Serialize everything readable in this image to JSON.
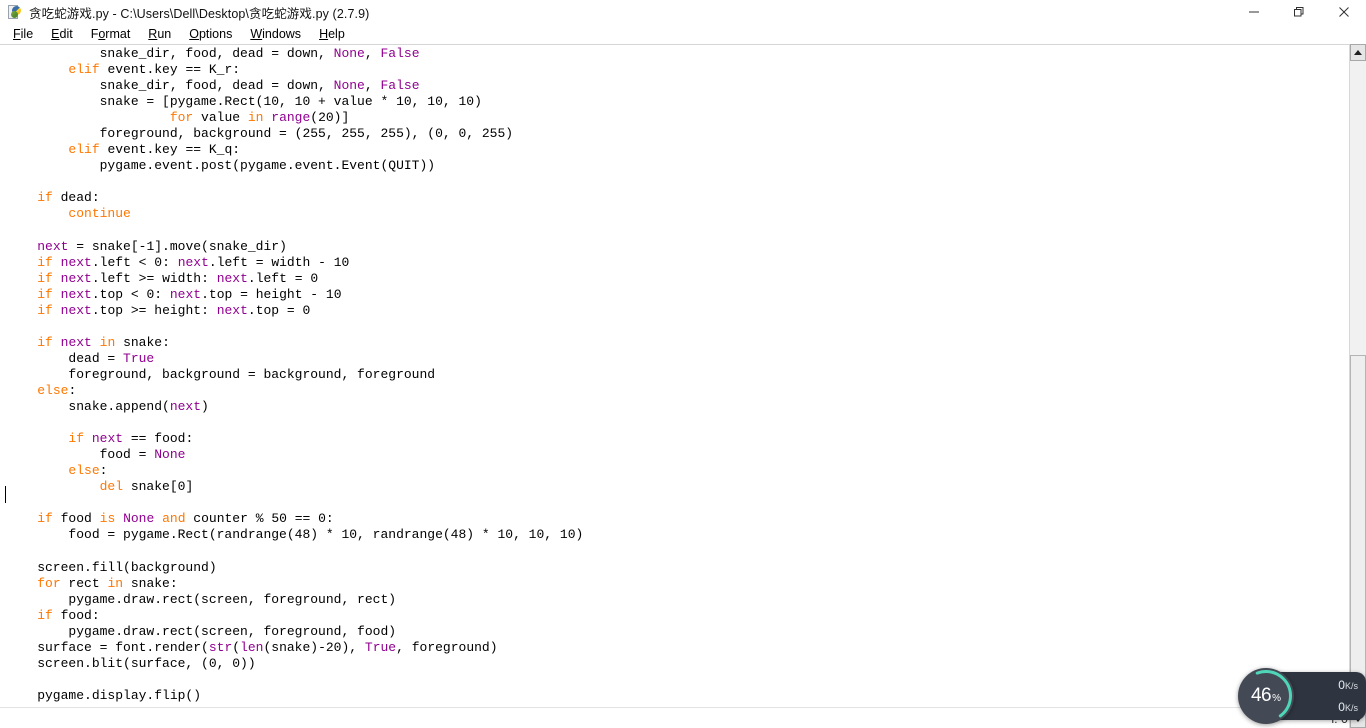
{
  "window": {
    "title": "贪吃蛇游戏.py - C:\\Users\\Dell\\Desktop\\贪吃蛇游戏.py (2.7.9)",
    "icon": "python-idle-icon",
    "controls": {
      "minimize": "minimize-icon",
      "restore": "restore-icon",
      "close": "close-icon"
    }
  },
  "menubar": {
    "items": [
      {
        "label": "File",
        "accel": "F"
      },
      {
        "label": "Edit",
        "accel": "E"
      },
      {
        "label": "Format",
        "accel": "o"
      },
      {
        "label": "Run",
        "accel": "R"
      },
      {
        "label": "Options",
        "accel": "O"
      },
      {
        "label": "Windows",
        "accel": "W"
      },
      {
        "label": "Help",
        "accel": "H"
      }
    ]
  },
  "editor": {
    "language": "python",
    "code_lines": [
      "            snake_dir, food, dead = down, None, False",
      "        elif event.key == K_r:",
      "            snake_dir, food, dead = down, None, False",
      "            snake = [pygame.Rect(10, 10 + value * 10, 10, 10)",
      "                     for value in range(20)]",
      "            foreground, background = (255, 255, 255), (0, 0, 255)",
      "        elif event.key == K_q:",
      "            pygame.event.post(pygame.event.Event(QUIT))",
      "",
      "    if dead:",
      "        continue",
      "",
      "    next = snake[-1].move(snake_dir)",
      "    if next.left < 0: next.left = width - 10",
      "    if next.left >= width: next.left = 0",
      "    if next.top < 0: next.top = height - 10",
      "    if next.top >= height: next.top = 0",
      "",
      "    if next in snake:",
      "        dead = True",
      "        foreground, background = background, foreground",
      "    else:",
      "        snake.append(next)",
      "",
      "        if next == food:",
      "            food = None",
      "        else:",
      "            del snake[0]",
      "",
      "    if food is None and counter % 50 == 0:",
      "        food = pygame.Rect(randrange(48) * 10, randrange(48) * 10, 10, 10)",
      "",
      "    screen.fill(background)",
      "    for rect in snake:",
      "        pygame.draw.rect(screen, foreground, rect)",
      "    if food:",
      "        pygame.draw.rect(screen, foreground, food)",
      "    surface = font.render(str(len(snake)-20), True, foreground)",
      "    screen.blit(surface, (0, 0))",
      "",
      "    pygame.display.flip()"
    ],
    "colors": {
      "keyword": "#ff7700",
      "builtin": "#900090",
      "string": "#00aa00",
      "comment": "#dd0000",
      "text": "#000000",
      "background": "#ffffff"
    }
  },
  "statusbar": {
    "text": "l: 0"
  },
  "scrollbar": {
    "up_arrow": "scroll-up-arrow-icon",
    "down_arrow": "scroll-down-arrow-icon"
  },
  "speed_widget": {
    "percent_value": "46",
    "percent_symbol": "%",
    "percent_number": 46,
    "ring_color": "#4fd6b8",
    "panel_color": "#2f3540",
    "upload": {
      "icon": "upload-arrow-icon",
      "rate": "0",
      "unit": "K/s"
    },
    "download": {
      "icon": "download-arrow-icon",
      "rate": "0",
      "unit": "K/s"
    }
  }
}
